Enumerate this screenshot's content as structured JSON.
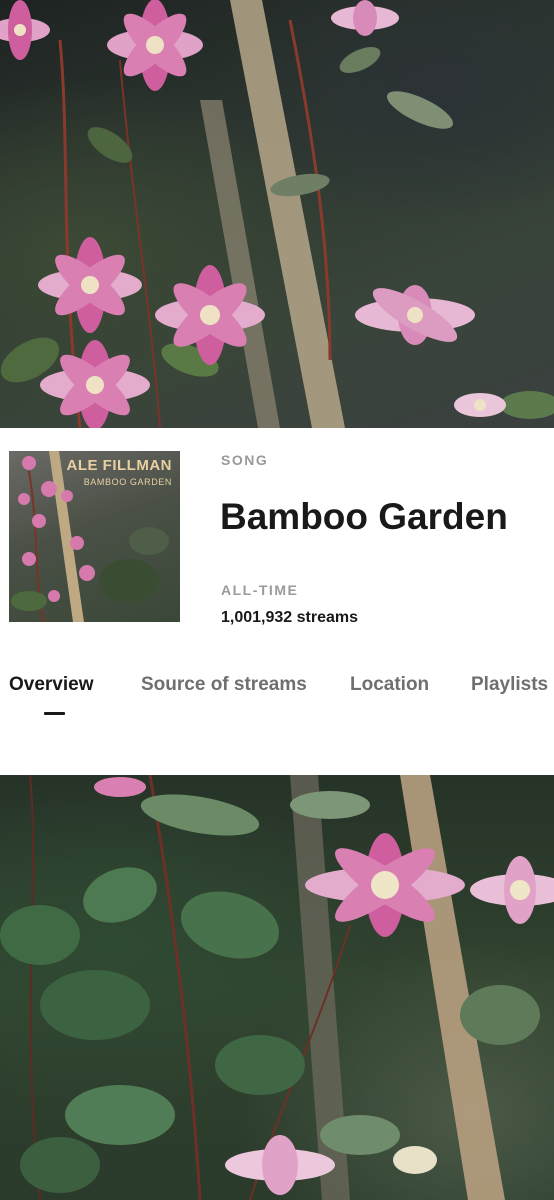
{
  "song": {
    "type_label": "SONG",
    "title": "Bamboo Garden",
    "alltime_label": "ALL-TIME",
    "streams": "1,001,932 streams"
  },
  "cover": {
    "artist_text": "ALE FILLMAN",
    "title_text": "BAMBOO GARDEN"
  },
  "tabs": [
    {
      "label": "Overview",
      "active": true
    },
    {
      "label": "Source of streams",
      "active": false
    },
    {
      "label": "Location",
      "active": false
    },
    {
      "label": "Playlists",
      "active": false
    }
  ],
  "colors": {
    "text_primary": "#191919",
    "text_secondary": "#9a9a9a",
    "tab_inactive": "#6f6f6f",
    "flower_pink": "#d66aa6"
  }
}
